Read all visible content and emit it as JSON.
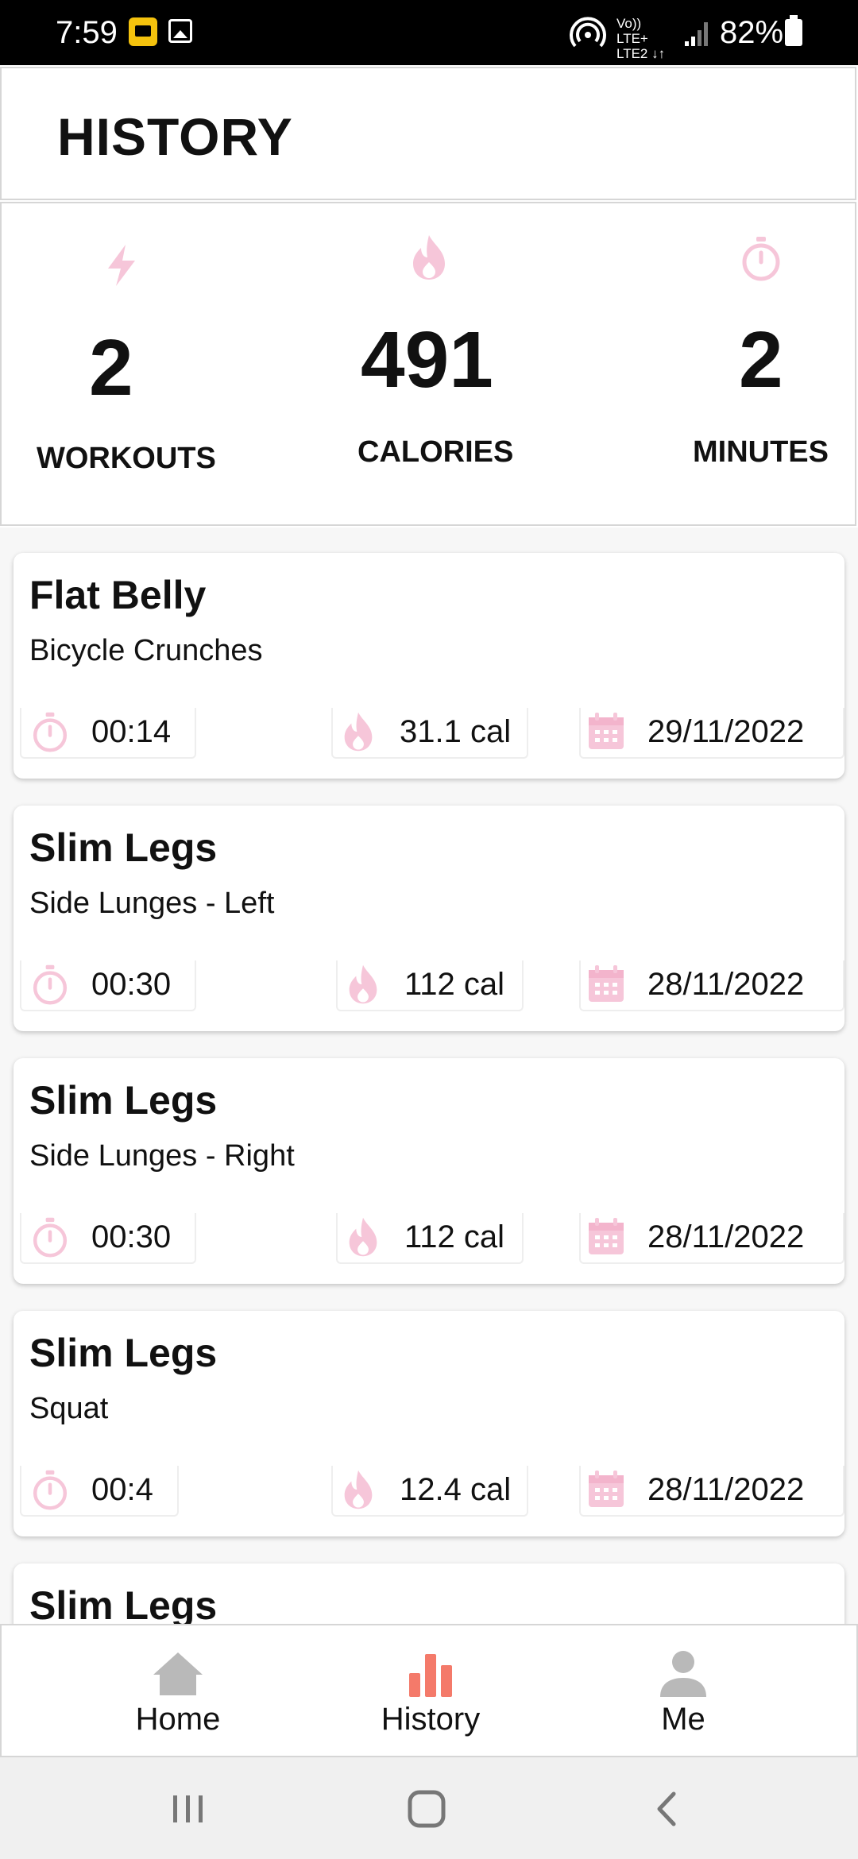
{
  "status_bar": {
    "time": "7:59",
    "network_top": "Vo)) LTE+",
    "network_bottom": "LTE2 ↓↑",
    "battery": "82%"
  },
  "header": {
    "title": "HISTORY"
  },
  "stats": {
    "workouts": {
      "value": "2",
      "label": "WORKOUTS",
      "icon": "lightning-icon"
    },
    "calories": {
      "value": "491",
      "label": "CALORIES",
      "icon": "flame-icon"
    },
    "minutes": {
      "value": "2",
      "label": "MINUTES",
      "icon": "stopwatch-icon"
    }
  },
  "history": [
    {
      "title": "Flat Belly",
      "exercise": "Bicycle Crunches",
      "duration": "00:14",
      "calories": "31.1 cal",
      "date": "29/11/2022"
    },
    {
      "title": "Slim Legs",
      "exercise": "Side Lunges - Left",
      "duration": "00:30",
      "calories": "112 cal",
      "date": "28/11/2022"
    },
    {
      "title": "Slim Legs",
      "exercise": "Side Lunges - Right",
      "duration": "00:30",
      "calories": "112 cal",
      "date": "28/11/2022"
    },
    {
      "title": "Slim Legs",
      "exercise": "Squat",
      "duration": "00:4",
      "calories": "12.4 cal",
      "date": "28/11/2022"
    },
    {
      "title": "Slim Legs"
    }
  ],
  "bottom_nav": {
    "home": "Home",
    "history": "History",
    "me": "Me",
    "active": "history"
  },
  "colors": {
    "accent_pink": "#f6c6d9",
    "active_nav": "#f47a6a",
    "inactive_nav": "#b9b9b9"
  }
}
